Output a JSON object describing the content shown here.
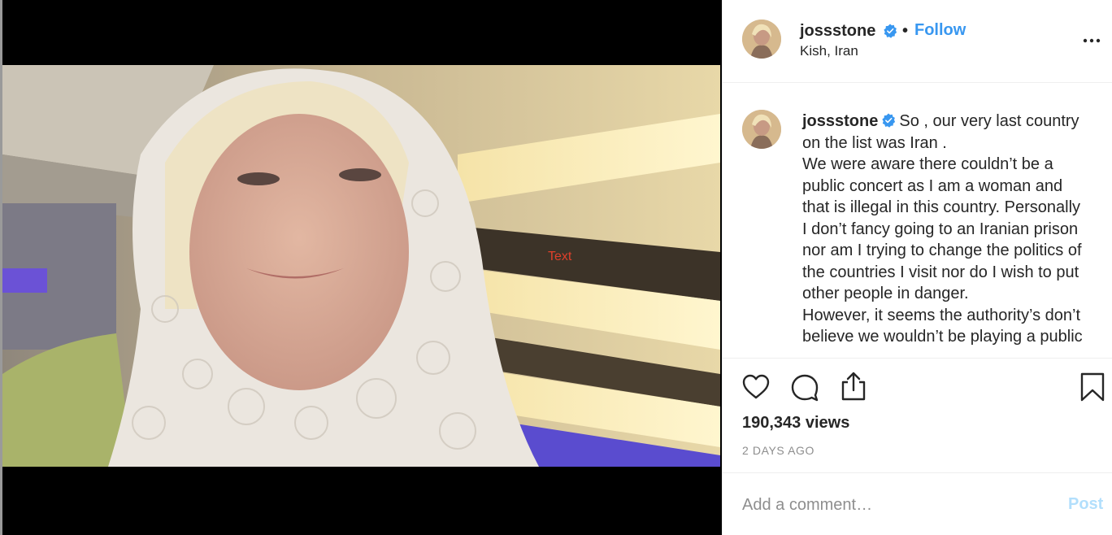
{
  "post": {
    "username": "jossstone",
    "location": "Kish, Iran",
    "follow_label": "Follow",
    "separator": "•",
    "video_overlay_text": "Text"
  },
  "caption": {
    "username": "jossstone",
    "lines": [
      "So , our very last country",
      "on the list was Iran .",
      "We were aware there couldn’t be a",
      "public concert as I am a woman and",
      "that is illegal in this country. Personally",
      "I don’t fancy going to an Iranian prison",
      "nor am I trying to change the politics of",
      "the countries I visit nor do I wish to put",
      "other people in danger.",
      "However, it seems the authority’s don’t",
      "believe we wouldn’t be playing a public"
    ]
  },
  "stats": {
    "views": "190,343 views",
    "time_ago": "2 DAYS AGO"
  },
  "comment": {
    "placeholder": "Add a comment…",
    "post_label": "Post"
  },
  "icons": {
    "verified": "verified-badge-icon",
    "more": "more-options-icon",
    "like": "heart-icon",
    "comment": "comment-icon",
    "share": "share-icon",
    "save": "bookmark-icon"
  },
  "colors": {
    "accent": "#3897f0",
    "post_disabled": "#b2dffc",
    "muted": "#8e8e8e",
    "overlay_text": "#e0402a"
  }
}
